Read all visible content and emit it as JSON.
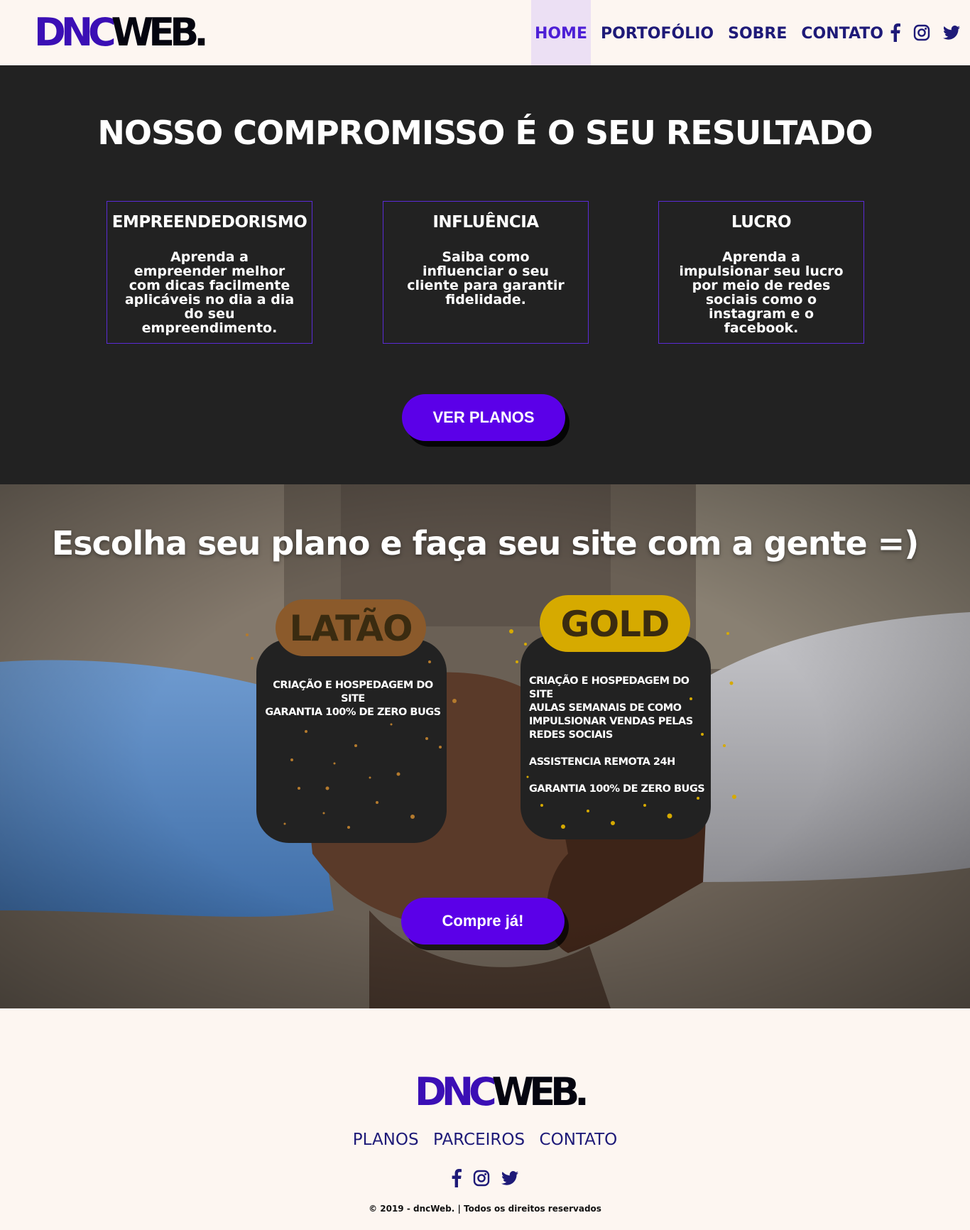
{
  "header": {
    "logo": {
      "part1": "DNC",
      "part2": "WEB",
      "dot": "."
    },
    "nav": [
      {
        "label": "HOME",
        "active": true
      },
      {
        "label": "PORTOFÓLIO"
      },
      {
        "label": "SOBRE"
      },
      {
        "label": "CONTATO"
      }
    ],
    "social": [
      "facebook-icon",
      "instagram-icon",
      "twitter-icon"
    ]
  },
  "commitment": {
    "title": "NOSSO COMPROMISSO É O SEU RESULTADO",
    "cards": [
      {
        "title": "EMPREENDEDORISMO",
        "text": "Aprenda a empreender melhor com dicas facilmente aplicáveis no dia a dia do seu empreendimento."
      },
      {
        "title": "INFLUÊNCIA",
        "text": "Saiba como influenciar o seu cliente para garantir fidelidade."
      },
      {
        "title": "LUCRO",
        "text": "Aprenda a impulsionar seu lucro por meio de redes sociais como o instagram e o facebook."
      }
    ],
    "cta_label": "VER PLANOS"
  },
  "plans": {
    "title": "Escolha seu plano e faça seu site com a gente =)",
    "items": [
      {
        "name": "LATÃO",
        "badge_color": "#8b5a2b",
        "features": [
          "CRIAÇÃO E HOSPEDAGEM DO SITE",
          "GARANTIA 100% DE ZERO BUGS"
        ]
      },
      {
        "name": "GOLD",
        "badge_color": "#d6aa00",
        "features": [
          "CRIAÇÃO E HOSPEDAGEM DO SITE",
          "AULAS SEMANAIS DE COMO IMPULSIONAR VENDAS PELAS REDES SOCIAIS",
          "ASSISTENCIA REMOTA 24H",
          "GARANTIA 100% DE ZERO BUGS"
        ]
      }
    ],
    "cta_label": "Compre já!"
  },
  "footer": {
    "logo": {
      "part1": "DNC",
      "part2": "WEB",
      "dot": "."
    },
    "links": [
      "PLANOS",
      "PARCEIROS",
      "CONTATO"
    ],
    "social": [
      "facebook-icon",
      "instagram-icon",
      "twitter-icon"
    ],
    "copyright": "© 2019 - dncWeb. | Todos os direitos reservados"
  },
  "colors": {
    "accent": "#5b00e8",
    "nav": "#1e1a78",
    "dark": "#222222",
    "background": "#fdf6f1"
  }
}
